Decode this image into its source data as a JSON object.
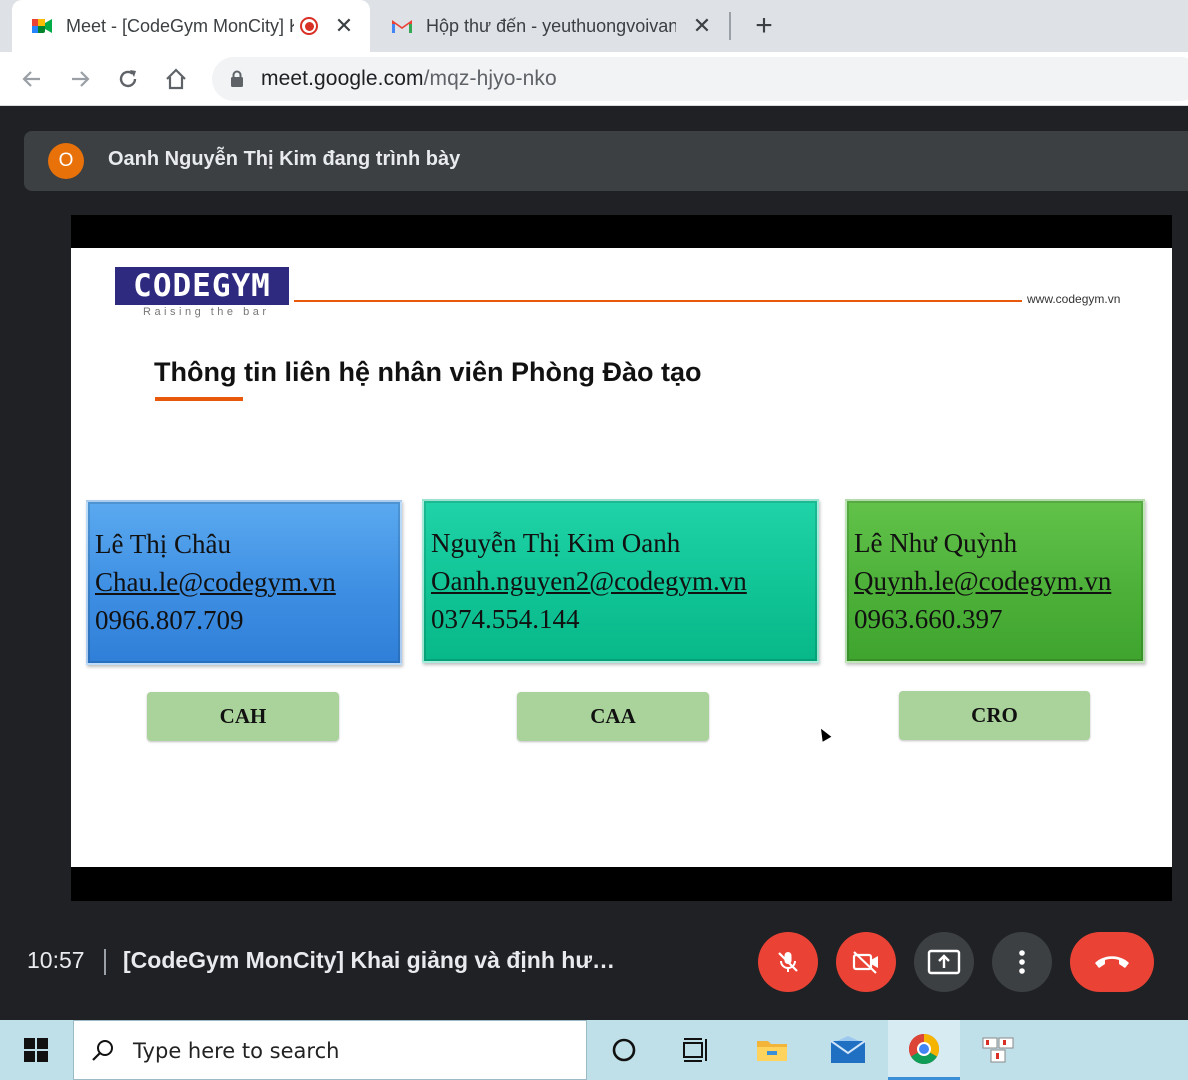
{
  "browser": {
    "tabs": [
      {
        "title": "Meet - [CodeGym MonCity] Khai giảng",
        "recording": true,
        "active": true
      },
      {
        "title": "Hộp thư đến - yeuthuongvoivang",
        "active": false
      }
    ],
    "url_host": "meet.google.com",
    "url_path": "/mqz-hjyo-nko"
  },
  "meet": {
    "presenter_initial": "O",
    "presenter_text": "Oanh Nguyễn Thị Kim đang trình bày",
    "clock": "10:57",
    "meeting_title": "[CodeGym MonCity] Khai giảng và định hư…",
    "controls": [
      "microphone-off",
      "camera-off",
      "present-now",
      "more-options",
      "leave-call"
    ]
  },
  "slide": {
    "logo_text": "CODEGYM",
    "logo_slogan": "Raising the bar",
    "website": "www.codegym.vn",
    "title": "Thông tin liên hệ nhân viên Phòng Đào tạo",
    "contacts": [
      {
        "name": "Lê Thị Châu",
        "email": "Chau.le@codegym.vn",
        "phone": "0966.807.709",
        "code": "CAH",
        "color": "#3e8fe3"
      },
      {
        "name": "Nguyễn Thị Kim Oanh",
        "email": "Oanh.nguyen2@codegym.vn",
        "phone": "0374.554.144",
        "code": "CAA",
        "color": "#10c496"
      },
      {
        "name": "Lê Như Quỳnh",
        "email": "Quynh.le@codegym.vn",
        "phone": "0963.660.397",
        "code": "CRO",
        "color": "#4db139"
      }
    ]
  },
  "taskbar": {
    "search_placeholder": "Type here to search",
    "pinned": [
      "cortana-icon",
      "task-view-icon",
      "file-explorer-icon",
      "mail-icon",
      "chrome-icon",
      "app-icon"
    ]
  }
}
